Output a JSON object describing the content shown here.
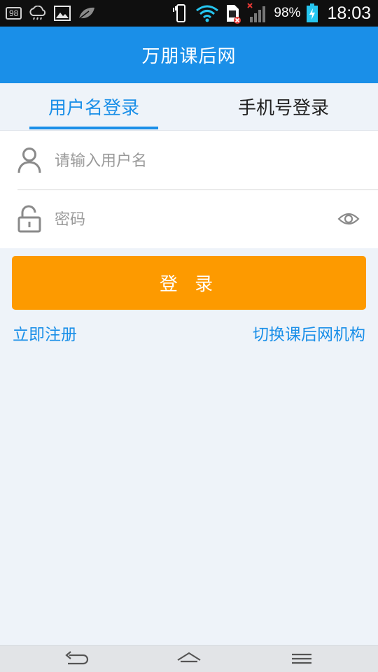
{
  "status_bar": {
    "notification_badge": "98",
    "battery_percent": "98%",
    "time": "18:03",
    "icons": [
      "notification-count-icon",
      "weather-cloud-icon",
      "gallery-image-icon",
      "leaf-icon",
      "vibrate-icon",
      "wifi-icon",
      "sim-error-icon",
      "signal-icon",
      "battery-charging-icon"
    ]
  },
  "app_bar": {
    "title": "万朋课后网"
  },
  "tabs": [
    {
      "label": "用户名登录",
      "active": true
    },
    {
      "label": "手机号登录",
      "active": false
    }
  ],
  "form": {
    "username": {
      "placeholder": "请输入用户名",
      "value": "",
      "icon": "user-icon"
    },
    "password": {
      "placeholder": "密码",
      "value": "",
      "icon": "lock-icon",
      "toggle_icon": "eye-icon"
    }
  },
  "login_button": {
    "label": "登 录"
  },
  "links": {
    "register": "立即注册",
    "switch_org": "切换课后网机构"
  },
  "nav_bar": {
    "icons": [
      "back-icon",
      "home-icon",
      "menu-icon"
    ]
  },
  "colors": {
    "primary": "#1a8fe8",
    "accent": "#fd9a00",
    "background": "#eef3f9"
  }
}
